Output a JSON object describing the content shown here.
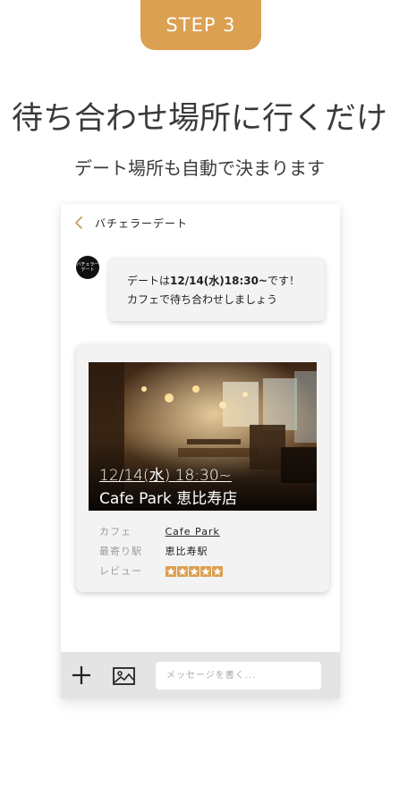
{
  "step": {
    "label": "STEP 3"
  },
  "headline": "待ち合わせ場所に行くだけ",
  "subline": "デート場所も自動で決まります",
  "chat": {
    "title": "バチェラーデート",
    "avatar_text": [
      "バチェラー",
      "デート"
    ],
    "message": {
      "line1_prefix": "デートは",
      "line1_bold": "12/14(水)18:30~",
      "line1_suffix": "です！",
      "line2": "カフェで待ち合わせしましょう"
    },
    "card": {
      "date_time": "12/14(水)  18:30~",
      "venue": "Cafe Park 恵比寿店",
      "rows": {
        "cafe_label": "カフェ",
        "cafe_value": "Cafe Park",
        "station_label": "最寄り駅",
        "station_value": "恵比寿駅",
        "review_label": "レビュー"
      },
      "rating": 5
    },
    "input": {
      "placeholder": "メッセージを書く..."
    }
  },
  "colors": {
    "accent": "#dba052",
    "card_bg": "#f3f3f3",
    "input_bar": "#e4e4e4"
  }
}
